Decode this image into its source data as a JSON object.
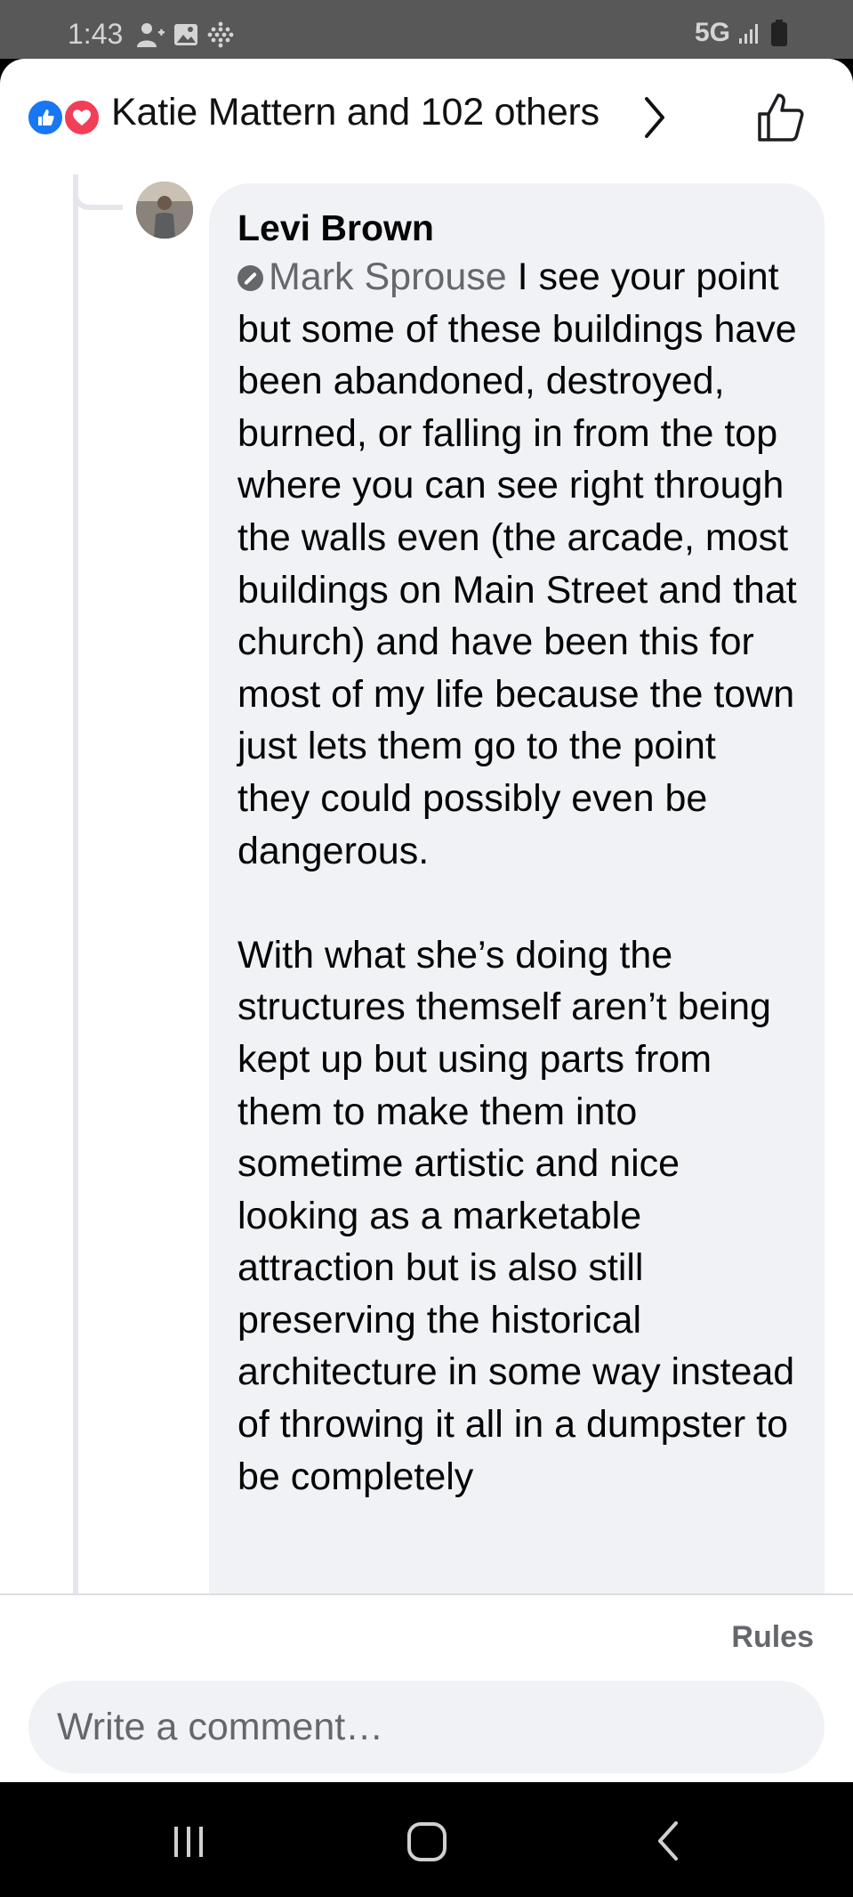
{
  "status_bar": {
    "time": "1:43",
    "network": "5G",
    "icons_left": [
      "add-contact-icon",
      "gallery-icon",
      "grid-dots-icon"
    ],
    "icons_right": [
      "signal-icon",
      "battery-icon"
    ]
  },
  "reactions_header": {
    "reaction_types": [
      "like",
      "love"
    ],
    "reactors_text": "Katie Mattern and 102 others",
    "colors": {
      "like": "#1877f2",
      "love": "#f33e58"
    }
  },
  "comment": {
    "author": "Levi Brown",
    "mention": "Mark Sprouse",
    "paragraph1": " I see your point but some of these buildings have been abandoned, destroyed, burned, or falling in from the top where you can see right through the walls even (the arcade, most buildings on Main Street and that church) and have been this for most of my life because the town just lets them go to the point they could possibly even be dangerous.",
    "paragraph2": "With what she’s doing the structures themself aren’t being kept up but using parts from them to make them into sometime artistic and nice looking as a marketable attraction but is also still preserving the historical architecture in some way instead of throwing it all in a dumpster to be completely"
  },
  "composer": {
    "rules_label": "Rules",
    "placeholder": "Write a comment…"
  },
  "nav_bar": {
    "buttons": [
      "recent-apps-icon",
      "home-icon",
      "back-icon"
    ]
  }
}
